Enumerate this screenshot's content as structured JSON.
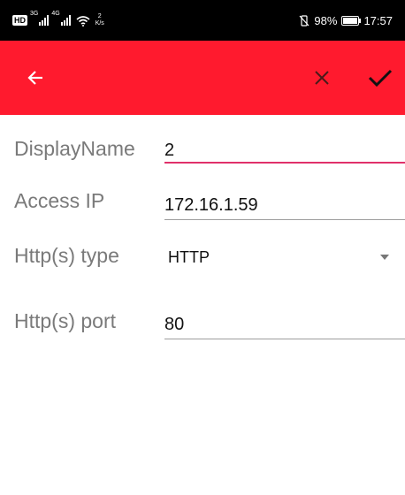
{
  "status_bar": {
    "hd": "HD",
    "net1": "3G",
    "net2": "4G",
    "speed_value": "2",
    "speed_unit": "K/s",
    "battery_percent": "98%",
    "time": "17:57"
  },
  "app_bar": {
    "color": "#ff1a2e",
    "back_icon": "arrow-left-icon",
    "close_icon": "close-icon",
    "confirm_icon": "check-icon"
  },
  "form": {
    "display_name": {
      "label": "DisplayName",
      "value": "2"
    },
    "access_ip": {
      "label": "Access IP",
      "value": "172.16.1.59"
    },
    "http_type": {
      "label": "Http(s) type",
      "selected": "HTTP"
    },
    "http_port": {
      "label": "Http(s) port",
      "value": "80"
    }
  }
}
